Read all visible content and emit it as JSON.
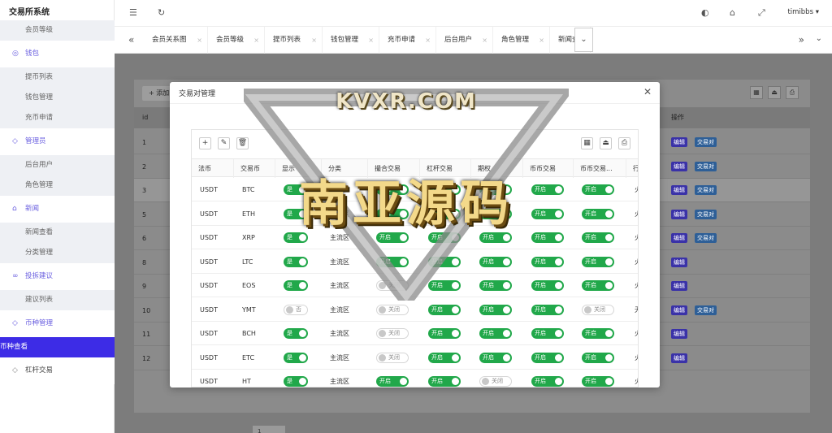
{
  "app": {
    "title": "交易所系统",
    "user": "timibbs"
  },
  "sidebar": {
    "rows": [
      {
        "type": "sub",
        "label": "会员等级"
      },
      {
        "type": "group",
        "label": "钱包",
        "icon": "wallet-icon",
        "glyph": "◎"
      },
      {
        "type": "sub",
        "label": "提币列表"
      },
      {
        "type": "sub",
        "label": "钱包管理"
      },
      {
        "type": "sub",
        "label": "充币申请"
      },
      {
        "type": "group",
        "label": "管理员",
        "icon": "shield-icon",
        "glyph": "◇"
      },
      {
        "type": "sub",
        "label": "后台用户"
      },
      {
        "type": "sub",
        "label": "角色管理"
      },
      {
        "type": "group",
        "label": "新闻",
        "icon": "tag-icon",
        "glyph": "⌂"
      },
      {
        "type": "sub",
        "label": "新闻查看"
      },
      {
        "type": "sub",
        "label": "分类管理"
      },
      {
        "type": "group",
        "label": "投拆建议",
        "icon": "link-icon",
        "glyph": "∞"
      },
      {
        "type": "sub",
        "label": "建议列表"
      },
      {
        "type": "group",
        "label": "币种管理",
        "icon": "diamond-icon",
        "glyph": "◇"
      },
      {
        "type": "active",
        "label": "币种查看"
      },
      {
        "type": "plain",
        "label": "杠杆交易",
        "icon": "diamond-icon",
        "glyph": "◇"
      }
    ]
  },
  "tabs": [
    "会员关系图",
    "会员等级",
    "提币列表",
    "钱包管理",
    "充币申请",
    "后台用户",
    "角色管理",
    "新闻查"
  ],
  "background_table": {
    "add_label": "添加",
    "id_header": "id",
    "op_header": "操作",
    "rows": [
      {
        "id": "1",
        "pair": true
      },
      {
        "id": "2",
        "pair": true
      },
      {
        "id": "3",
        "pair": true
      },
      {
        "id": "5",
        "pair": true
      },
      {
        "id": "6",
        "pair": true
      },
      {
        "id": "8",
        "pair": false
      },
      {
        "id": "9",
        "pair": false
      },
      {
        "id": "10",
        "pair": true
      },
      {
        "id": "11",
        "pair": false
      },
      {
        "id": "12",
        "pair": false
      }
    ],
    "edit_label": "编辑",
    "pair_label": "交易对",
    "page": "1"
  },
  "modal": {
    "title": "交易对管理",
    "columns": [
      "法币",
      "交易币",
      "显示",
      "分类",
      "撮合交易",
      "杠杆交易",
      "期权",
      "币币交易",
      "币币交易...",
      "行"
    ],
    "rows": [
      {
        "fiat": "USDT",
        "coin": "BTC",
        "show": "是",
        "cat": "主流区",
        "match": "开启",
        "lever": "开启",
        "option": "开启",
        "c2c": "开启",
        "c2c2": "开启",
        "more": "火"
      },
      {
        "fiat": "USDT",
        "coin": "ETH",
        "show": "是",
        "cat": "主流区",
        "match": "开启",
        "lever": "开启",
        "option": "开启",
        "c2c": "开启",
        "c2c2": "开启",
        "more": "火"
      },
      {
        "fiat": "USDT",
        "coin": "XRP",
        "show": "是",
        "cat": "主流区",
        "match": "开启",
        "lever": "开启",
        "option": "开启",
        "c2c": "开启",
        "c2c2": "开启",
        "more": "火"
      },
      {
        "fiat": "USDT",
        "coin": "LTC",
        "show": "是",
        "cat": "主流区",
        "match": "开启",
        "lever": "开启",
        "option": "开启",
        "c2c": "开启",
        "c2c2": "开启",
        "more": "火"
      },
      {
        "fiat": "USDT",
        "coin": "EOS",
        "show": "是",
        "cat": "主流区",
        "match": "关闭",
        "lever": "开启",
        "option": "开启",
        "c2c": "开启",
        "c2c2": "开启",
        "more": "火"
      },
      {
        "fiat": "USDT",
        "coin": "YMT",
        "show": "否",
        "cat": "主流区",
        "match": "关闭",
        "lever": "开启",
        "option": "开启",
        "c2c": "开启",
        "c2c2": "关闭",
        "more": "无"
      },
      {
        "fiat": "USDT",
        "coin": "BCH",
        "show": "是",
        "cat": "主流区",
        "match": "关闭",
        "lever": "开启",
        "option": "开启",
        "c2c": "开启",
        "c2c2": "开启",
        "more": "火"
      },
      {
        "fiat": "USDT",
        "coin": "ETC",
        "show": "是",
        "cat": "主流区",
        "match": "关闭",
        "lever": "开启",
        "option": "开启",
        "c2c": "开启",
        "c2c2": "开启",
        "more": "火"
      },
      {
        "fiat": "USDT",
        "coin": "HT",
        "show": "是",
        "cat": "主流区",
        "match": "开启",
        "lever": "开启",
        "option": "关闭",
        "c2c": "开启",
        "c2c2": "开启",
        "more": "火"
      }
    ]
  },
  "watermark": {
    "line1": "KVXR.COM",
    "line2": "南亚源码"
  },
  "colors": {
    "accent": "#3d2ce6",
    "switch_on": "#21a84a",
    "tag_edit": "#3a32a8",
    "tag_pair": "#2e5f97"
  }
}
